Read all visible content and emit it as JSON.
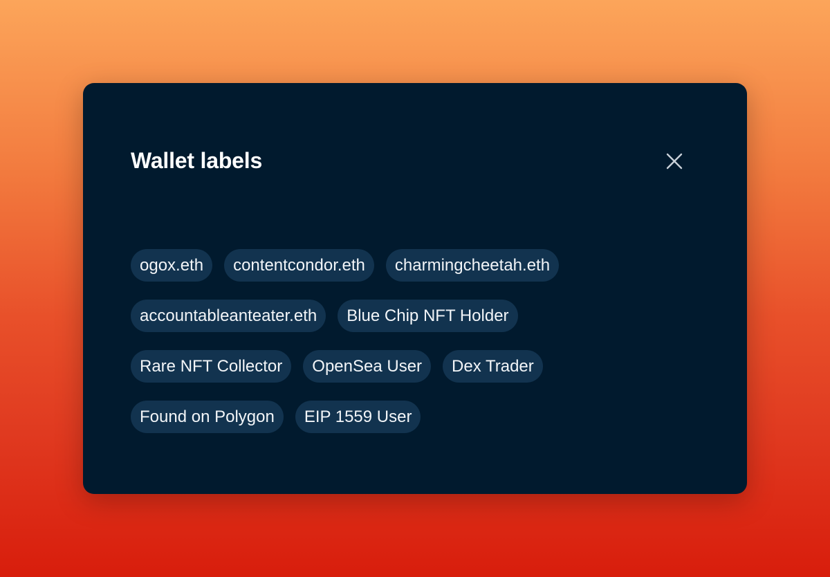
{
  "modal": {
    "title": "Wallet labels",
    "close_icon": "close-icon"
  },
  "labels": [
    "ogox.eth",
    "contentcondor.eth",
    "charmingcheetah.eth",
    "accountableanteater.eth",
    "Blue Chip NFT Holder",
    "Rare NFT Collector",
    "OpenSea User",
    "Dex Trader",
    "Found on Polygon",
    "EIP 1559 User"
  ],
  "colors": {
    "modal_background": "#011a2e",
    "chip_background": "#12334f",
    "chip_text": "#f2f5f8",
    "title_text": "#ffffff",
    "close_icon": "#c9d1d9",
    "background_top": "#fca55a",
    "background_bottom": "#d81d0c"
  }
}
